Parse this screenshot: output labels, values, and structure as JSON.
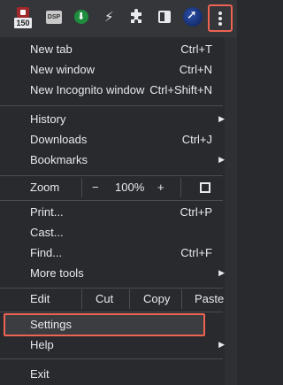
{
  "toolbar": {
    "ext_badge": "150",
    "ext_dsp_label": "DSP",
    "icons": [
      "ublock-icon",
      "dsp-icon",
      "download-icon",
      "bolt-icon",
      "puzzle-icon",
      "side-panel-icon",
      "avatar",
      "kebab-menu-icon"
    ]
  },
  "menu": {
    "new_tab": {
      "label": "New tab",
      "shortcut": "Ctrl+T"
    },
    "new_window": {
      "label": "New window",
      "shortcut": "Ctrl+N"
    },
    "new_incognito": {
      "label": "New Incognito window",
      "shortcut": "Ctrl+Shift+N"
    },
    "history": {
      "label": "History"
    },
    "downloads": {
      "label": "Downloads",
      "shortcut": "Ctrl+J"
    },
    "bookmarks": {
      "label": "Bookmarks"
    },
    "zoom": {
      "label": "Zoom",
      "minus": "−",
      "value": "100%",
      "plus": "+"
    },
    "print": {
      "label": "Print...",
      "shortcut": "Ctrl+P"
    },
    "cast": {
      "label": "Cast..."
    },
    "find": {
      "label": "Find...",
      "shortcut": "Ctrl+F"
    },
    "more_tools": {
      "label": "More tools"
    },
    "edit": {
      "label": "Edit",
      "cut": "Cut",
      "copy": "Copy",
      "paste": "Paste"
    },
    "settings": {
      "label": "Settings"
    },
    "help": {
      "label": "Help"
    },
    "exit": {
      "label": "Exit"
    }
  },
  "colors": {
    "highlight": "#ee6352",
    "menu_bg": "#292a2d"
  }
}
